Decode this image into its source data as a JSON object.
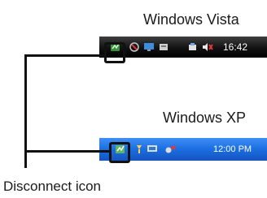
{
  "vista": {
    "label": "Windows Vista",
    "clock": "16:42",
    "tray_icons": [
      "disconnect-icon",
      "network-icon",
      "monitor-icon",
      "device-icon",
      "speaker-muted-icon"
    ]
  },
  "xp": {
    "label": "Windows XP",
    "clock": "12:00 PM",
    "tray_icons": [
      "disconnect-icon",
      "network-icon",
      "monitor-icon",
      "usb-icon"
    ]
  },
  "callout": {
    "label": "Disconnect icon"
  },
  "colors": {
    "vista_taskbar": "#111111",
    "xp_taskbar": "#1b6ee0",
    "callout_line": "#111111"
  }
}
